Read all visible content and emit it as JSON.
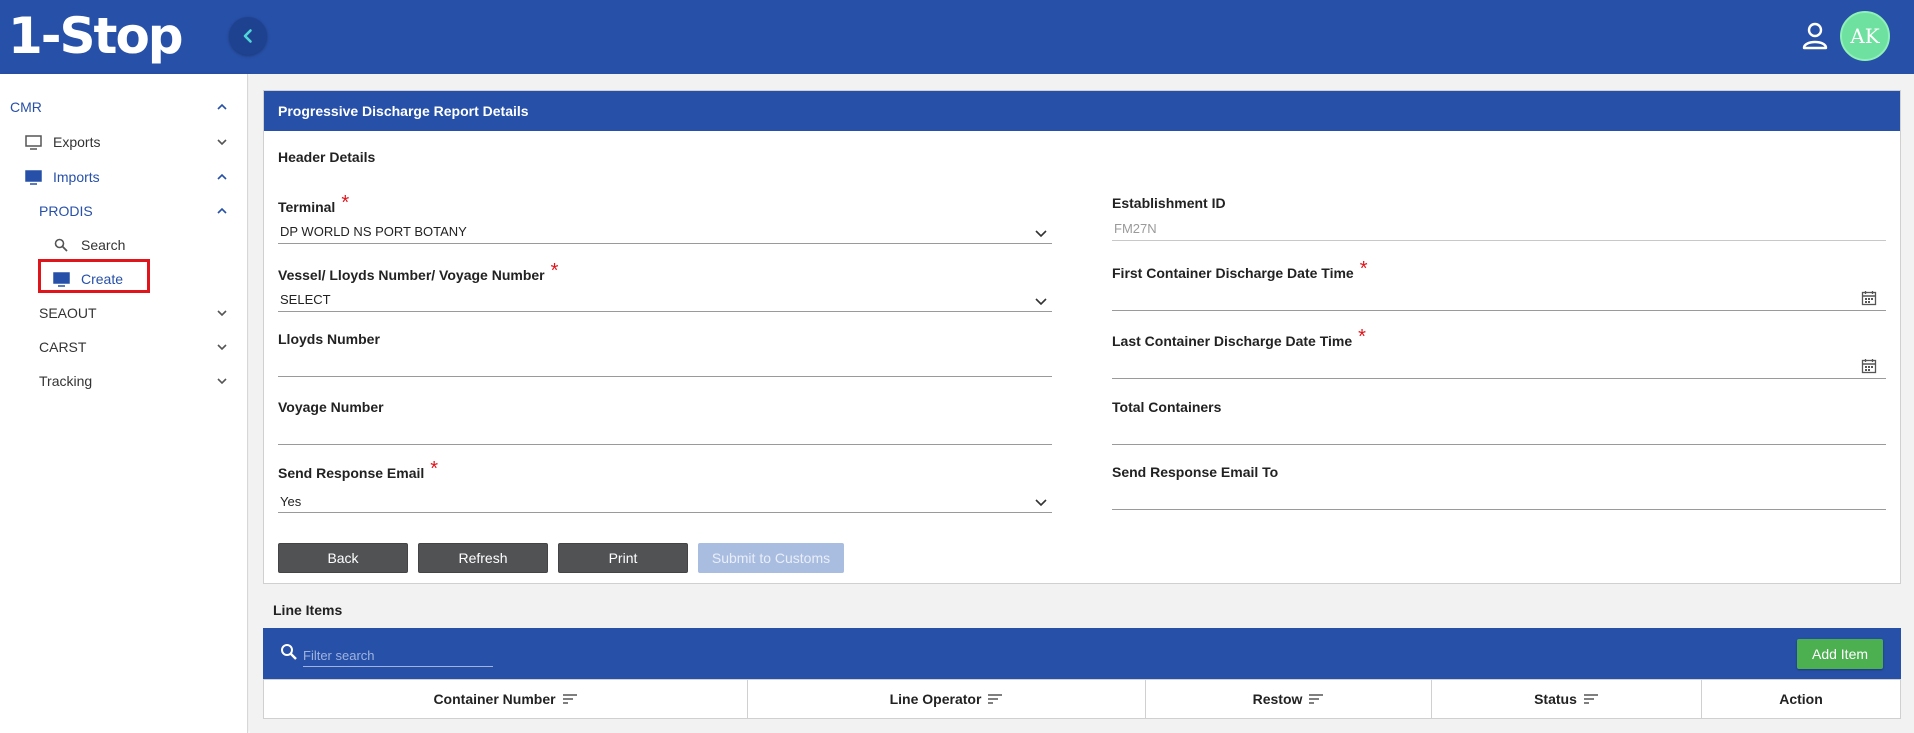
{
  "app": {
    "logo_text": "1-Stop",
    "avatar_initials": "AK"
  },
  "sidebar": {
    "cmr": "CMR",
    "exports": "Exports",
    "imports": "Imports",
    "prodis": "PRODIS",
    "search": "Search",
    "create": "Create",
    "seaout": "SEAOUT",
    "carst": "CARST",
    "tracking": "Tracking"
  },
  "card": {
    "title": "Progressive Discharge Report Details",
    "header_details": "Header Details",
    "fields": {
      "terminal_label": "Terminal",
      "terminal_value": "DP WORLD NS PORT BOTANY",
      "vessel_label": "Vessel/ Lloyds Number/ Voyage Number",
      "vessel_value": "SELECT",
      "lloyds_label": "Lloyds Number",
      "voyage_label": "Voyage Number",
      "send_email_label": "Send Response Email",
      "send_email_value": "Yes",
      "establishment_label": "Establishment ID",
      "establishment_value": "FM27N",
      "first_discharge_label": "First Container Discharge Date Time",
      "last_discharge_label": "Last Container Discharge Date Time",
      "total_containers_label": "Total Containers",
      "send_email_to_label": "Send Response Email To"
    },
    "required_mark": "*",
    "buttons": {
      "back": "Back",
      "refresh": "Refresh",
      "print": "Print",
      "submit": "Submit to Customs"
    }
  },
  "line_items": {
    "title": "Line Items",
    "search_placeholder": "Filter search",
    "add_item": "Add Item",
    "columns": [
      "Container Number",
      "Line Operator",
      "Restow",
      "Status",
      "Action"
    ]
  },
  "colors": {
    "primary": "#2750a8",
    "required": "#e0141b",
    "add_button": "#4caf50",
    "highlight_box": "#e0141b"
  }
}
